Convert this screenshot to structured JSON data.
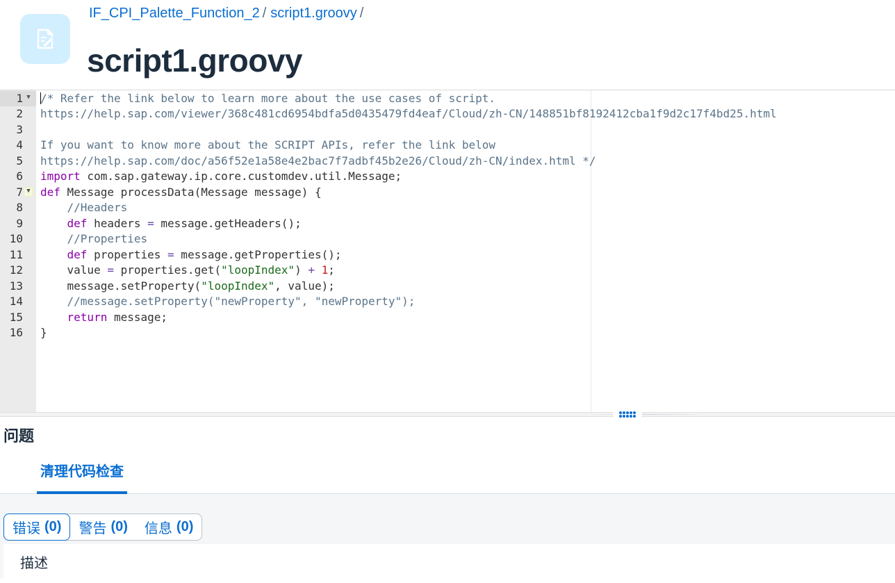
{
  "breadcrumb": {
    "items": [
      "IF_CPI_Palette_Function_2",
      "script1.groovy"
    ],
    "separator": "/"
  },
  "page_title": "script1.groovy",
  "editor": {
    "line_numbers": [
      "1",
      "2",
      "3",
      "4",
      "5",
      "6",
      "7",
      "8",
      "9",
      "10",
      "11",
      "12",
      "13",
      "14",
      "15",
      "16"
    ],
    "fold_lines": [
      1,
      7
    ],
    "active_line": 1,
    "lines": [
      [
        {
          "t": "comment",
          "v": "/* Refer the link below to learn more about the use cases of script."
        }
      ],
      [
        {
          "t": "comment",
          "v": "https://help.sap.com/viewer/368c481cd6954bdfa5d0435479fd4eaf/Cloud/zh-CN/148851bf8192412cba1f9d2c17f4bd25.html"
        }
      ],
      [],
      [
        {
          "t": "comment",
          "v": "If you want to know more about the SCRIPT APIs, refer the link below"
        }
      ],
      [
        {
          "t": "comment",
          "v": "https://help.sap.com/doc/a56f52e1a58e4e2bac7f7adbf45b2e26/Cloud/zh-CN/index.html */"
        }
      ],
      [
        {
          "t": "kw",
          "v": "import"
        },
        {
          "t": "plain",
          "v": " com.sap.gateway.ip.core.customdev.util.Message;"
        }
      ],
      [
        {
          "t": "kw",
          "v": "def"
        },
        {
          "t": "plain",
          "v": " Message processData(Message message) {"
        }
      ],
      [
        {
          "t": "plain",
          "v": "    "
        },
        {
          "t": "comment",
          "v": "//Headers"
        }
      ],
      [
        {
          "t": "plain",
          "v": "    "
        },
        {
          "t": "kw",
          "v": "def"
        },
        {
          "t": "plain",
          "v": " headers "
        },
        {
          "t": "op",
          "v": "="
        },
        {
          "t": "plain",
          "v": " message.getHeaders();"
        }
      ],
      [
        {
          "t": "plain",
          "v": "    "
        },
        {
          "t": "comment",
          "v": "//Properties"
        }
      ],
      [
        {
          "t": "plain",
          "v": "    "
        },
        {
          "t": "kw",
          "v": "def"
        },
        {
          "t": "plain",
          "v": " properties "
        },
        {
          "t": "op",
          "v": "="
        },
        {
          "t": "plain",
          "v": " message.getProperties();"
        }
      ],
      [
        {
          "t": "plain",
          "v": "    value "
        },
        {
          "t": "op",
          "v": "="
        },
        {
          "t": "plain",
          "v": " properties.get("
        },
        {
          "t": "str",
          "v": "\"loopIndex\""
        },
        {
          "t": "plain",
          "v": ") "
        },
        {
          "t": "op",
          "v": "+"
        },
        {
          "t": "plain",
          "v": " "
        },
        {
          "t": "num",
          "v": "1"
        },
        {
          "t": "plain",
          "v": ";"
        }
      ],
      [
        {
          "t": "plain",
          "v": "    message.setProperty("
        },
        {
          "t": "str",
          "v": "\"loopIndex\""
        },
        {
          "t": "plain",
          "v": ", value);"
        }
      ],
      [
        {
          "t": "plain",
          "v": "    "
        },
        {
          "t": "comment",
          "v": "//message.setProperty(\"newProperty\", \"newProperty\");"
        }
      ],
      [
        {
          "t": "plain",
          "v": "    "
        },
        {
          "t": "kw",
          "v": "return"
        },
        {
          "t": "plain",
          "v": " message;"
        }
      ],
      [
        {
          "t": "plain",
          "v": "}"
        }
      ]
    ]
  },
  "problems": {
    "title": "问题",
    "tabs": [
      {
        "label": "清理代码检查"
      }
    ],
    "filters": [
      {
        "label": "错误",
        "count": "(0)"
      },
      {
        "label": "警告",
        "count": "(0)"
      },
      {
        "label": "信息",
        "count": "(0)"
      }
    ],
    "selected_filter": 0,
    "table_header": "描述"
  },
  "colors": {
    "accent": "#0a6ed1",
    "icon_bg": "#d1efff",
    "keyword": "#8a00a6",
    "comment": "#5b7489",
    "string": "#1a6b1a",
    "number": "#c41a16"
  },
  "icons": {
    "header": "edit-document-icon",
    "fold": "chevron-down-icon",
    "splitter": "grip-icon"
  }
}
